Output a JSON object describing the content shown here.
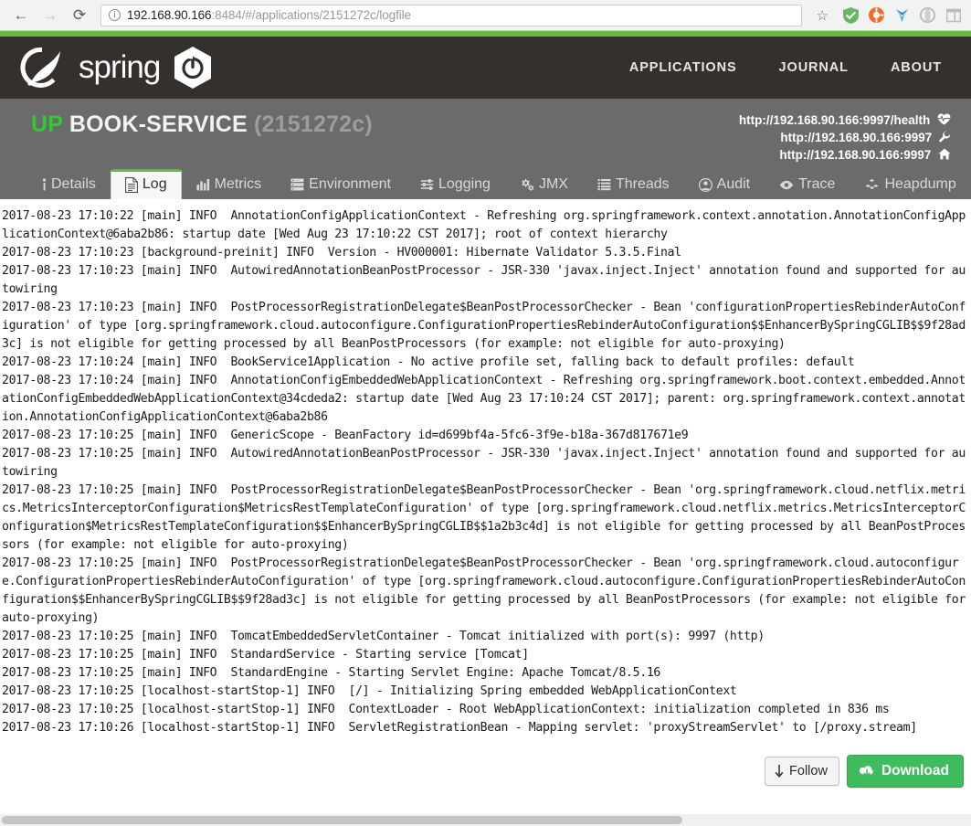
{
  "browser": {
    "back_label": "←",
    "forward_label": "→",
    "reload_label": "⟳",
    "url_host": "192.168.90.166",
    "url_rest": ":8484/#/applications/2151272c/logfile",
    "url_full": "192.168.90.166:8484/#/applications/2151272c/logfile",
    "star_label": "☆",
    "extensions": [
      "shield-icon",
      "adblock-icon",
      "yandex-icon",
      "opera-icon",
      "panel-icon"
    ]
  },
  "header": {
    "brand": "spring",
    "nav": [
      {
        "label": "APPLICATIONS"
      },
      {
        "label": "JOURNAL"
      },
      {
        "label": "ABOUT"
      }
    ]
  },
  "app": {
    "status": "UP",
    "name": "BOOK-SERVICE",
    "id": "(2151272c)",
    "endpoints": [
      {
        "url": "http://192.168.90.166:9997/health",
        "icon": "heartbeat-icon"
      },
      {
        "url": "http://192.168.90.166:9997",
        "icon": "wrench-icon"
      },
      {
        "url": "http://192.168.90.166:9997",
        "icon": "home-icon"
      }
    ]
  },
  "tabs": [
    {
      "label": "Details",
      "icon": "info-icon",
      "active": false
    },
    {
      "label": "Log",
      "icon": "file-icon",
      "active": true
    },
    {
      "label": "Metrics",
      "icon": "bar-chart-icon",
      "active": false
    },
    {
      "label": "Environment",
      "icon": "server-icon",
      "active": false
    },
    {
      "label": "Logging",
      "icon": "sliders-icon",
      "active": false
    },
    {
      "label": "JMX",
      "icon": "gears-icon",
      "active": false
    },
    {
      "label": "Threads",
      "icon": "list-icon",
      "active": false
    },
    {
      "label": "Audit",
      "icon": "user-circle-icon",
      "active": false
    },
    {
      "label": "Trace",
      "icon": "eye-icon",
      "active": false
    },
    {
      "label": "Heapdump",
      "icon": "cubes-icon",
      "active": false
    }
  ],
  "log": {
    "content": "2017-08-23 17:10:22 [main] INFO  AnnotationConfigApplicationContext - Refreshing org.springframework.context.annotation.AnnotationConfigApplicationContext@6aba2b86: startup date [Wed Aug 23 17:10:22 CST 2017]; root of context hierarchy\n2017-08-23 17:10:23 [background-preinit] INFO  Version - HV000001: Hibernate Validator 5.3.5.Final\n2017-08-23 17:10:23 [main] INFO  AutowiredAnnotationBeanPostProcessor - JSR-330 'javax.inject.Inject' annotation found and supported for autowiring\n2017-08-23 17:10:23 [main] INFO  PostProcessorRegistrationDelegate$BeanPostProcessorChecker - Bean 'configurationPropertiesRebinderAutoConfiguration' of type [org.springframework.cloud.autoconfigure.ConfigurationPropertiesRebinderAutoConfiguration$$EnhancerBySpringCGLIB$$9f28ad3c] is not eligible for getting processed by all BeanPostProcessors (for example: not eligible for auto-proxying)\n2017-08-23 17:10:24 [main] INFO  BookService1Application - No active profile set, falling back to default profiles: default\n2017-08-23 17:10:24 [main] INFO  AnnotationConfigEmbeddedWebApplicationContext - Refreshing org.springframework.boot.context.embedded.AnnotationConfigEmbeddedWebApplicationContext@34cdeda2: startup date [Wed Aug 23 17:10:24 CST 2017]; parent: org.springframework.context.annotation.AnnotationConfigApplicationContext@6aba2b86\n2017-08-23 17:10:25 [main] INFO  GenericScope - BeanFactory id=d699bf4a-5fc6-3f9e-b18a-367d817671e9\n2017-08-23 17:10:25 [main] INFO  AutowiredAnnotationBeanPostProcessor - JSR-330 'javax.inject.Inject' annotation found and supported for autowiring\n2017-08-23 17:10:25 [main] INFO  PostProcessorRegistrationDelegate$BeanPostProcessorChecker - Bean 'org.springframework.cloud.netflix.metrics.MetricsInterceptorConfiguration$MetricsRestTemplateConfiguration' of type [org.springframework.cloud.netflix.metrics.MetricsInterceptorConfiguration$MetricsRestTemplateConfiguration$$EnhancerBySpringCGLIB$$1a2b3c4d] is not eligible for getting processed by all BeanPostProcessors (for example: not eligible for auto-proxying)\n2017-08-23 17:10:25 [main] INFO  PostProcessorRegistrationDelegate$BeanPostProcessorChecker - Bean 'org.springframework.cloud.autoconfigure.ConfigurationPropertiesRebinderAutoConfiguration' of type [org.springframework.cloud.autoconfigure.ConfigurationPropertiesRebinderAutoConfiguration$$EnhancerBySpringCGLIB$$9f28ad3c] is not eligible for getting processed by all BeanPostProcessors (for example: not eligible for auto-proxying)\n2017-08-23 17:10:25 [main] INFO  TomcatEmbeddedServletContainer - Tomcat initialized with port(s): 9997 (http)\n2017-08-23 17:10:25 [main] INFO  StandardService - Starting service [Tomcat]\n2017-08-23 17:10:25 [main] INFO  StandardEngine - Starting Servlet Engine: Apache Tomcat/8.5.16\n2017-08-23 17:10:25 [localhost-startStop-1] INFO  [/] - Initializing Spring embedded WebApplicationContext\n2017-08-23 17:10:25 [localhost-startStop-1] INFO  ContextLoader - Root WebApplicationContext: initialization completed in 836 ms\n2017-08-23 17:10:26 [localhost-startStop-1] INFO  ServletRegistrationBean - Mapping servlet: 'proxyStreamServlet' to [/proxy.stream]",
    "follow_label": "Follow",
    "follow_icon": "arrow-down-icon",
    "download_label": "Download",
    "download_icon": "cloud-download-icon"
  },
  "colors": {
    "accent_green": "#5fba46",
    "header_dark": "#34302d",
    "subheader_grey": "#6b6b6b",
    "status_up": "#2ecc2e",
    "download_green": "#3fbd5e"
  }
}
